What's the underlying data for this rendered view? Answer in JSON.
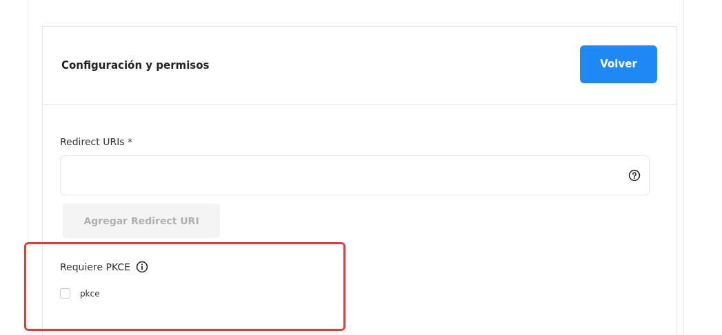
{
  "card": {
    "title": "Configuración y permisos",
    "back_button": "Volver"
  },
  "redirect_uris": {
    "label": "Redirect URIs *",
    "add_button": {
      "label": "Agregar Redirect URI",
      "disabled": true
    }
  },
  "pkce": {
    "label": "Requiere PKCE",
    "highlighted": true,
    "checkbox": {
      "label": "pkce",
      "checked": false
    }
  }
}
